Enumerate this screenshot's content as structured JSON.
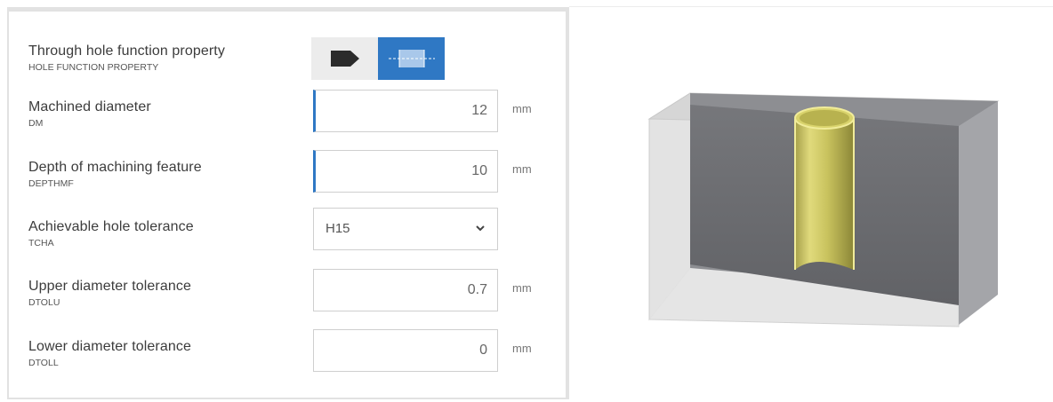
{
  "form": {
    "fields": [
      {
        "label": "Through hole function property",
        "code": "HOLE FUNCTION PROPERTY"
      },
      {
        "label": "Machined diameter",
        "code": "DM",
        "value": "12",
        "unit": "mm"
      },
      {
        "label": "Depth of machining feature",
        "code": "DEPTHMF",
        "value": "10",
        "unit": "mm"
      },
      {
        "label": "Achievable hole tolerance",
        "code": "TCHA",
        "value": "H15"
      },
      {
        "label": "Upper diameter tolerance",
        "code": "DTOLU",
        "value": "0.7",
        "unit": "mm"
      },
      {
        "label": "Lower diameter tolerance",
        "code": "DTOLL",
        "value": "0",
        "unit": "mm"
      }
    ],
    "hole_function_options": [
      {
        "icon": "blind-hole-icon",
        "selected": false
      },
      {
        "icon": "through-hole-icon",
        "selected": true
      }
    ]
  },
  "colors": {
    "accent": "#2f78c4",
    "hole_highlight": "#d8d26a"
  }
}
